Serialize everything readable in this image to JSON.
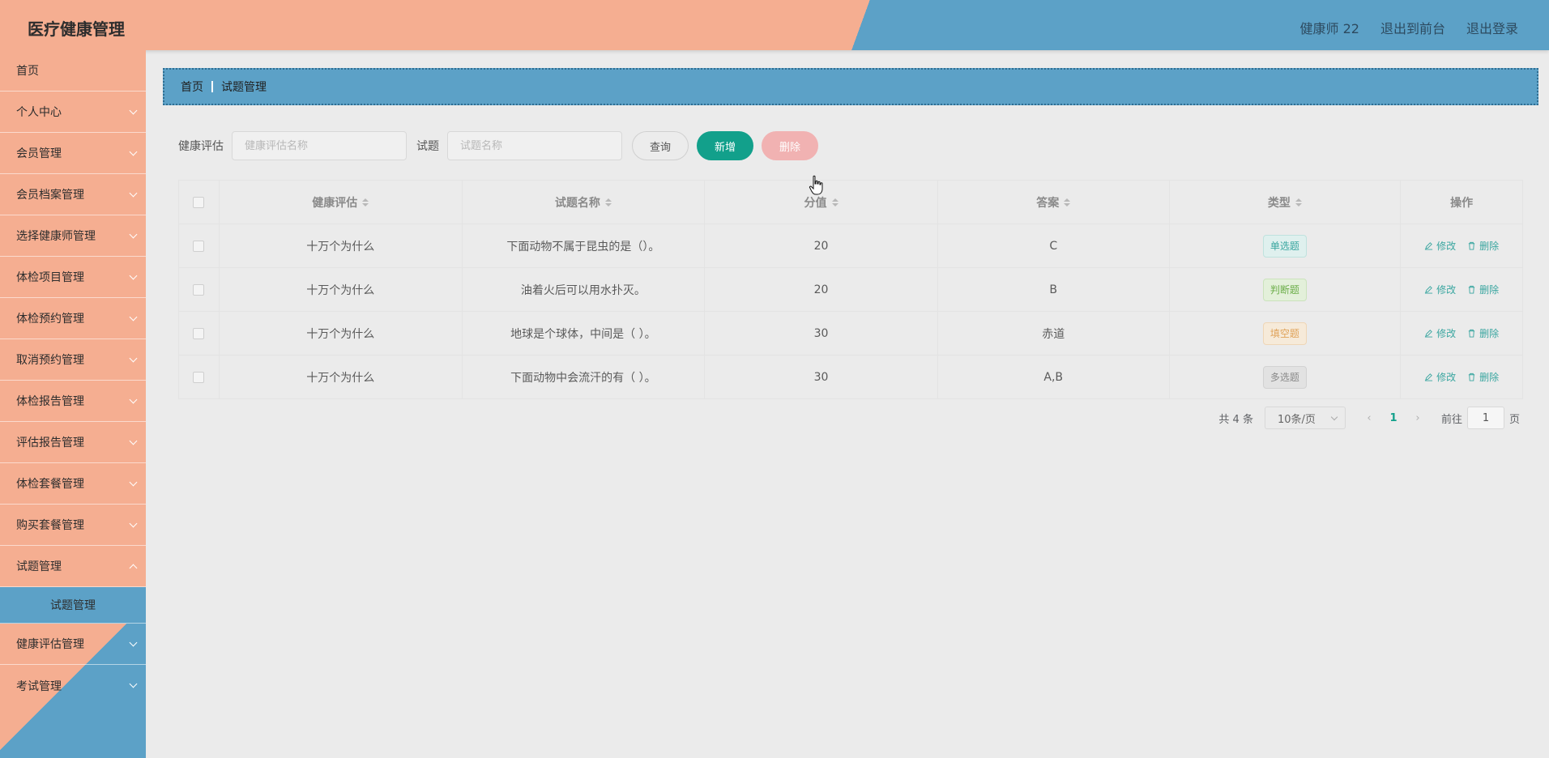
{
  "app": {
    "title": "医疗健康管理"
  },
  "header": {
    "user": "健康师 22",
    "to_front": "退出到前台",
    "logout": "退出登录"
  },
  "sidebar": {
    "items": [
      {
        "label": "首页"
      },
      {
        "label": "个人中心"
      },
      {
        "label": "会员管理"
      },
      {
        "label": "会员档案管理"
      },
      {
        "label": "选择健康师管理"
      },
      {
        "label": "体检项目管理"
      },
      {
        "label": "体检预约管理"
      },
      {
        "label": "取消预约管理"
      },
      {
        "label": "体检报告管理"
      },
      {
        "label": "评估报告管理"
      },
      {
        "label": "体检套餐管理"
      },
      {
        "label": "购买套餐管理"
      },
      {
        "label": "试题管理"
      },
      {
        "label": "健康评估管理"
      },
      {
        "label": "考试管理"
      }
    ],
    "active_sub": "试题管理"
  },
  "breadcrumb": {
    "home": "首页",
    "current": "试题管理"
  },
  "search": {
    "label1": "健康评估",
    "placeholder1": "健康评估名称",
    "label2": "试题",
    "placeholder2": "试题名称",
    "query": "查询",
    "add": "新增",
    "delete": "删除"
  },
  "table": {
    "headers": [
      "健康评估",
      "试题名称",
      "分值",
      "答案",
      "类型",
      "操作"
    ],
    "rows": [
      {
        "assessment": "十万个为什么",
        "question": "下面动物不属于昆虫的是（）。",
        "score": "20",
        "answer": "C",
        "type": "单选题"
      },
      {
        "assessment": "十万个为什么",
        "question": "油着火后可以用水扑灭。",
        "score": "20",
        "answer": "B",
        "type": "判断题"
      },
      {
        "assessment": "十万个为什么",
        "question": "地球是个球体，中间是（ ）。",
        "score": "30",
        "answer": "赤道",
        "type": "填空题"
      },
      {
        "assessment": "十万个为什么",
        "question": "下面动物中会流汗的有（ ）。",
        "score": "30",
        "answer": "A,B",
        "type": "多选题"
      }
    ],
    "edit": "修改",
    "del": "删除"
  },
  "pagination": {
    "total": "共 4 条",
    "page_size": "10条/页",
    "current": "1",
    "goto": "前往",
    "goto_value": "1",
    "page_unit": "页"
  }
}
